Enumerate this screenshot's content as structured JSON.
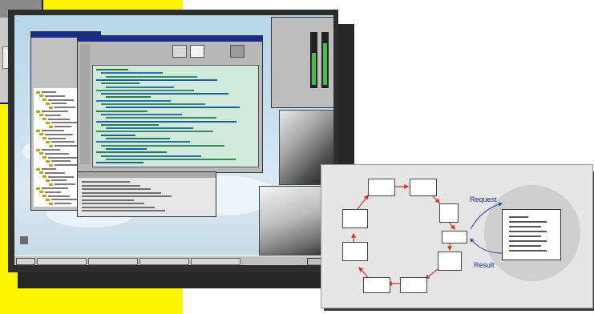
{
  "colors": {
    "accent_yellow": "#fff500",
    "titlebar": "#1a2b8a",
    "code_bg": "#cfeada",
    "arrow_red": "#d8342a",
    "arrow_blue": "#2e3fb8"
  },
  "diagram": {
    "request_label": "Request",
    "result_label": "Result",
    "side_label": "",
    "caption_left": "",
    "caption_right": "",
    "nodes": []
  },
  "icons": [
    "start-button-icon",
    "desktop-computer-icon",
    "window-title-bar-icon"
  ]
}
